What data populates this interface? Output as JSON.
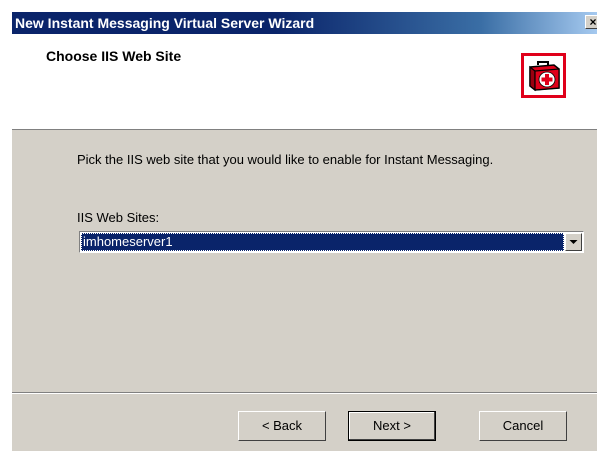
{
  "window": {
    "title": "New Instant Messaging Virtual Server Wizard",
    "close_glyph": "×"
  },
  "header": {
    "title": "Choose IIS Web Site",
    "icon": "first-aid-kit-icon",
    "icon_border_color": "#e0001a"
  },
  "body": {
    "instruction": "Pick the IIS web site that you would like to enable for Instant Messaging.",
    "sites_label": "IIS Web Sites:",
    "sites_selected": "imhomeserver1"
  },
  "buttons": {
    "back": "< Back",
    "next": "Next >",
    "cancel": "Cancel"
  },
  "colors": {
    "titlebar": "#0a246a",
    "face": "#d4d0c8",
    "selection": "#0a246a"
  }
}
